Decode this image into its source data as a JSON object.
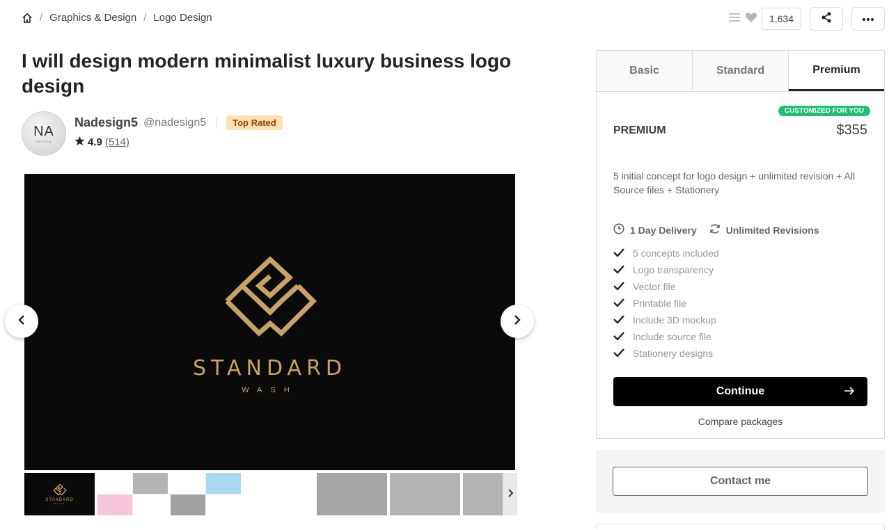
{
  "breadcrumb": {
    "items": [
      "Graphics & Design",
      "Logo Design"
    ]
  },
  "actions": {
    "likes_count": "1,634"
  },
  "gig": {
    "title": "I will design modern minimalist luxury business logo design"
  },
  "seller": {
    "avatar_text": "NA",
    "avatar_sub": "DESIGN",
    "name": "Nadesign5",
    "handle": "@nadesign5",
    "badge": "Top Rated",
    "rating": "4.9",
    "reviews": "(514)"
  },
  "gallery": {
    "brand_main": "STANDARD",
    "brand_sub": "WASH",
    "thumb_brand": "STANDARD",
    "thumb_sub": "WASH",
    "accent": "#c9a267"
  },
  "package": {
    "tabs": [
      "Basic",
      "Standard",
      "Premium"
    ],
    "active_tab": "Premium",
    "badge": "CUSTOMIZED FOR YOU",
    "name": "PREMIUM",
    "price": "$355",
    "description": "5 initial concept for logo design + unlimited revision + All Source files + Stationery",
    "delivery": "1 Day Delivery",
    "revisions": "Unlimited Revisions",
    "features": [
      "5 concepts included",
      "Logo transparency",
      "Vector file",
      "Printable file",
      "Include 3D mockup",
      "Include source file",
      "Stationery designs"
    ],
    "continue_label": "Continue",
    "compare_label": "Compare packages"
  },
  "contact": {
    "label": "Contact me"
  },
  "colors": {
    "green": "#1dbf73",
    "badge_bg": "#ffe0b3",
    "badge_text": "#8f4300"
  }
}
